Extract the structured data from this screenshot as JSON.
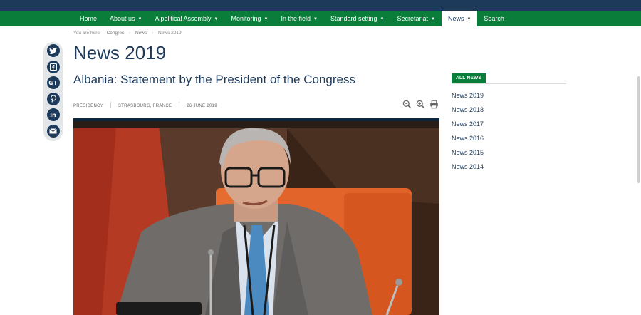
{
  "nav": {
    "items": [
      {
        "label": "Home",
        "dropdown": false
      },
      {
        "label": "About us",
        "dropdown": true
      },
      {
        "label": "A political Assembly",
        "dropdown": true
      },
      {
        "label": "Monitoring",
        "dropdown": true
      },
      {
        "label": "In the field",
        "dropdown": true
      },
      {
        "label": "Standard setting",
        "dropdown": true
      },
      {
        "label": "Secretariat",
        "dropdown": true
      },
      {
        "label": "News",
        "dropdown": true,
        "active": true
      },
      {
        "label": "Search",
        "dropdown": false
      }
    ],
    "caret": "▼"
  },
  "breadcrumb": {
    "prefix": "You are here:",
    "items": [
      "Congres",
      "News",
      "News 2019"
    ],
    "separator": "›"
  },
  "page_title": "News 2019",
  "article": {
    "title": "Albania: Statement by the President of the Congress",
    "category": "Presidency",
    "location": "Strasbourg, France",
    "date": "26 June 2019"
  },
  "tools": {
    "icons": [
      "zoom-out-icon",
      "zoom-in-icon",
      "print-icon"
    ]
  },
  "social": {
    "icons": [
      "twitter-icon",
      "facebook-icon",
      "google-plus-icon",
      "pinterest-icon",
      "linkedin-icon",
      "email-icon"
    ]
  },
  "sidebar": {
    "header": "ALL NEWS",
    "items": [
      "News 2019",
      "News 2018",
      "News 2017",
      "News 2016",
      "News 2015",
      "News 2014"
    ]
  },
  "colors": {
    "navy": "#1d3a5b",
    "green": "#0a7d3b",
    "social_bg": "#e3e6e9"
  }
}
